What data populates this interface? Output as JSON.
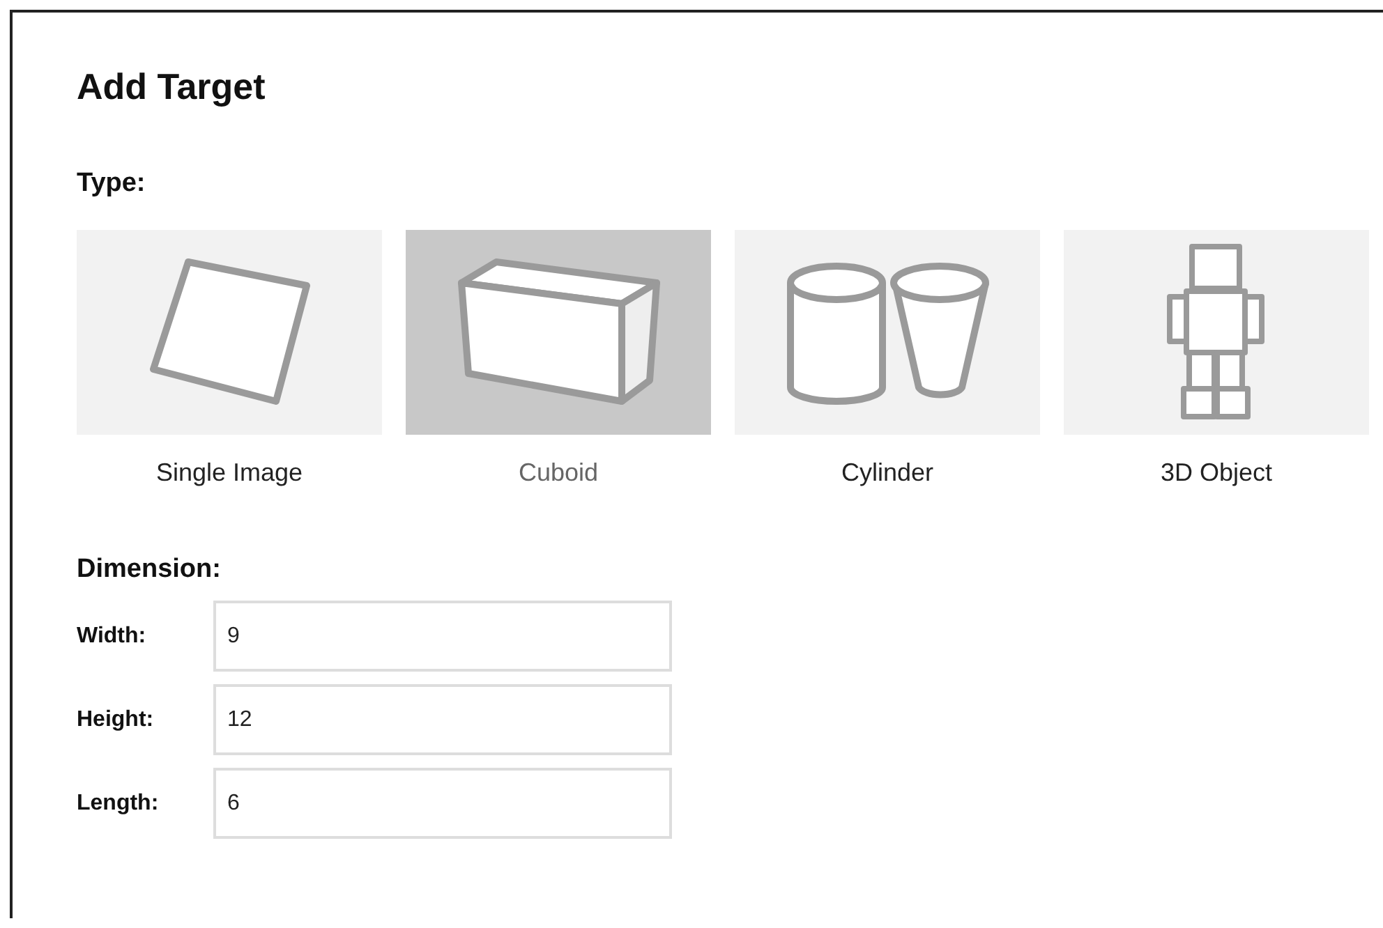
{
  "title": "Add Target",
  "type_section": {
    "heading": "Type:",
    "options": [
      {
        "kind": "image",
        "label": "Single Image",
        "selected": false
      },
      {
        "kind": "cuboid",
        "label": "Cuboid",
        "selected": true
      },
      {
        "kind": "cylinder",
        "label": "Cylinder",
        "selected": false
      },
      {
        "kind": "object",
        "label": "3D Object",
        "selected": false
      }
    ]
  },
  "dimension_section": {
    "heading": "Dimension:",
    "fields": [
      {
        "label": "Width:",
        "value": "9"
      },
      {
        "label": "Height:",
        "value": "12"
      },
      {
        "label": "Length:",
        "value": "6"
      }
    ]
  }
}
